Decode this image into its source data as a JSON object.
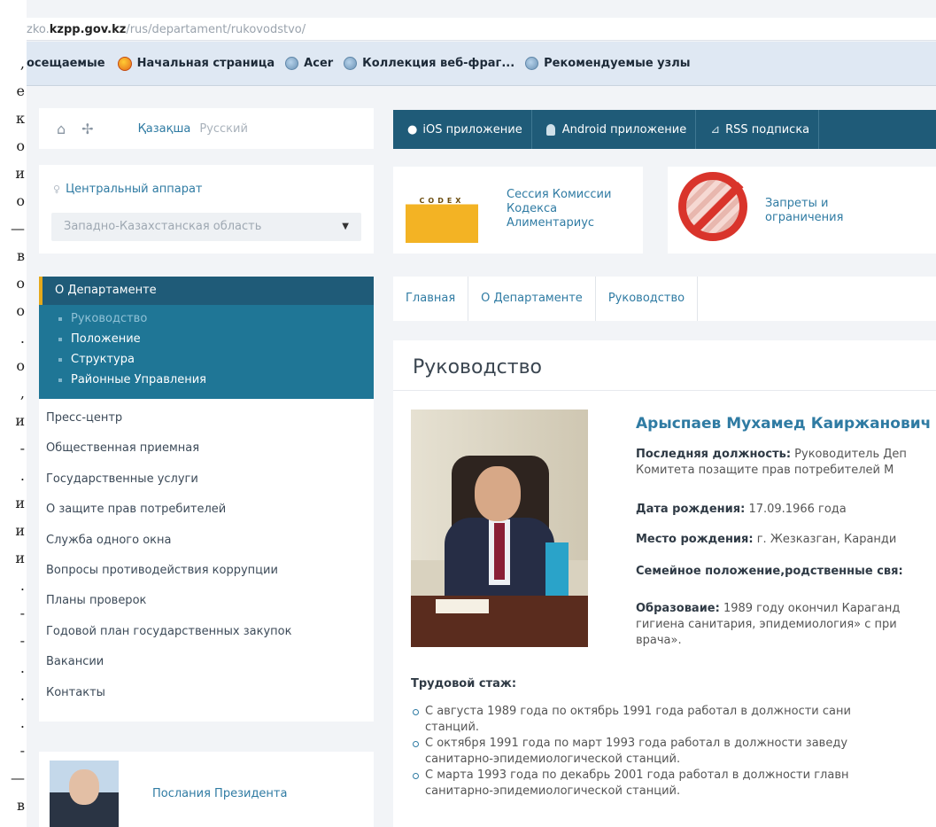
{
  "margin_text": [
    ",",
    "e",
    "к",
    "о",
    "и",
    "о",
    "—",
    "в",
    "о",
    "о",
    ".",
    "о",
    ",",
    "и",
    "-",
    ".",
    "и",
    "и",
    "и",
    ".",
    "-",
    "-",
    ".",
    ".",
    ".",
    "-",
    "—",
    "в"
  ],
  "address_bar": {
    "prefix": "zko.",
    "host": "kzpp.gov.kz",
    "path": "/rus/departament/rukovodstvo/"
  },
  "bookmarks": [
    {
      "label": "осещаемые",
      "icon": "none"
    },
    {
      "label": "Начальная страница",
      "icon": "firefox-icon"
    },
    {
      "label": "Acer",
      "icon": "globe-icon"
    },
    {
      "label": "Коллекция веб-фраг...",
      "icon": "globe-icon"
    },
    {
      "label": "Рекомендуемые узлы",
      "icon": "globe-icon"
    }
  ],
  "lang": {
    "kazakh": "Қазақша",
    "russian": "Русский"
  },
  "region": {
    "title": "Центральный аппарат",
    "selected": "Западно-Казахстанская область"
  },
  "menu": {
    "head": "О Департаменте",
    "sub": [
      "Руководство",
      "Положение",
      "Структура",
      "Районные Управления"
    ],
    "items": [
      "Пресс-центр",
      "Общественная приемная",
      "Государственные услуги",
      "О защите прав потребителей",
      "Служба одного окна",
      "Вопросы противодействия коррупции",
      "Планы проверок",
      "Годовой план государственных закупок",
      "Вакансии",
      "Контакты"
    ]
  },
  "president_link": "Послания Президента",
  "topnav": {
    "ios": "iOS приложение",
    "android": "Android приложение",
    "rss": "RSS подписка"
  },
  "banners": {
    "codex_logo_text": "CODEX",
    "codex": "Сессия Комиссии Кодекса Алиментариус",
    "bans": "Запреты и ограничения"
  },
  "breadcrumb": [
    "Главная",
    "О Департаменте",
    "Руководство"
  ],
  "page": {
    "title": "Руководство",
    "name": "Арыспаев Мухамед Каиржанович",
    "position_label": "Последняя должность:",
    "position_value": "Руководитель Деп",
    "position_cont": "Комитета позащите прав потребителей М",
    "birth_label": "Дата рождения:",
    "birth_value": "17.09.1966 года",
    "place_label": "Место рождения:",
    "place_value": "г. Жезказган, Каранди",
    "family_label": "Семейное положение,родственные свя:",
    "edu_label": "Образоваие:",
    "edu_value": "1989 году окончил Караганд",
    "edu_cont1": "гигиена санитария, эпидемиология» с при",
    "edu_cont2": "врача».",
    "stage_title": "Трудовой стаж:",
    "stage": [
      {
        "line1": "С августа 1989 года по октябрь 1991 года работал в должности сани",
        "line2": "станций."
      },
      {
        "line1": "С октября 1991 года по март 1993 года работал в должности заведу",
        "line2": "санитарно-эпидемиологической станций."
      },
      {
        "line1": "С марта 1993 года по декабрь 2001 года работал в должности главн",
        "line2": "санитарно-эпидемиологической станций."
      }
    ]
  }
}
